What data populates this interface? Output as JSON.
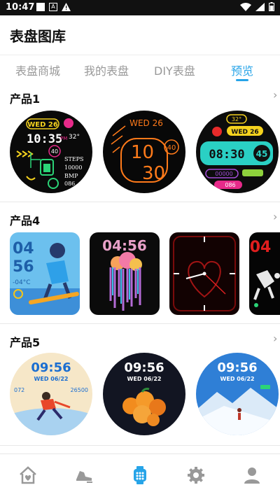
{
  "status": {
    "time": "10:47"
  },
  "header": {
    "title": "表盘图库"
  },
  "tabs": [
    {
      "label": "表盘商城",
      "active": false
    },
    {
      "label": "我的表盘",
      "active": false
    },
    {
      "label": "DIY表盘",
      "active": false
    },
    {
      "label": "预览",
      "active": true
    }
  ],
  "sections": [
    {
      "title": "产品1",
      "faces": [
        {
          "day": "WED 26",
          "time": "10:35",
          "ampm": "PM",
          "temp": "32°",
          "steps_label": "STEPS",
          "steps": "10000",
          "bmp_label": "BMP",
          "bmp": "086",
          "badge": "40"
        },
        {
          "day": "WED 26",
          "hour": "10",
          "minute": "30",
          "badge": "40"
        },
        {
          "temp": "32°",
          "day": "WED 26",
          "time": "08:30",
          "badge": "45",
          "steps": "00000",
          "hr": "086"
        }
      ]
    },
    {
      "title": "产品4",
      "faces": [
        {
          "hour": "04",
          "minute": "56",
          "temp": "-04°C"
        },
        {
          "time": "04:56"
        },
        {
          "style": "analog-heart"
        },
        {
          "time": "04"
        }
      ]
    },
    {
      "title": "产品5",
      "faces": [
        {
          "time": "09:56",
          "date": "WED 06/22",
          "left": "072",
          "right": "26500"
        },
        {
          "time": "09:56",
          "date": "WED 06/22"
        },
        {
          "time": "09:56",
          "date": "WED 06/22"
        }
      ]
    }
  ],
  "nav": [
    {
      "icon": "home-icon",
      "active": false
    },
    {
      "icon": "running-shoe-icon",
      "active": false
    },
    {
      "icon": "watch-icon",
      "active": true
    },
    {
      "icon": "gear-icon",
      "active": false
    },
    {
      "icon": "user-icon",
      "active": false
    }
  ],
  "colors": {
    "accent": "#27a4e8",
    "inactive": "#999999"
  }
}
